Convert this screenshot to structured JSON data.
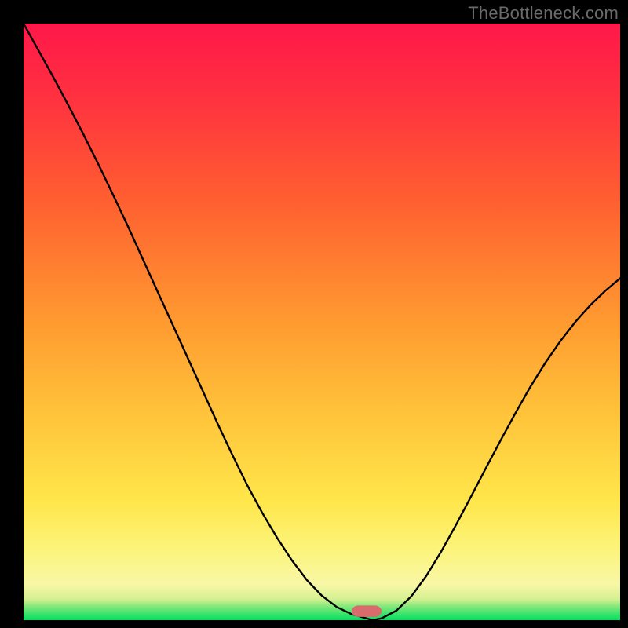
{
  "watermark": "TheBottleneck.com",
  "colors": {
    "black": "#000000",
    "curve": "#000000",
    "marker": "#d86b6b"
  },
  "chart_data": {
    "type": "line",
    "title": "",
    "xlabel": "",
    "ylabel": "",
    "xlim": [
      0,
      100
    ],
    "ylim": [
      0,
      100
    ],
    "gradient_background": {
      "stops": [
        {
          "pos": 0.0,
          "color": "#00e060"
        },
        {
          "pos": 0.022,
          "color": "#7de87a"
        },
        {
          "pos": 0.035,
          "color": "#d4f090"
        },
        {
          "pos": 0.06,
          "color": "#f8f7a6"
        },
        {
          "pos": 0.12,
          "color": "#fcf47a"
        },
        {
          "pos": 0.2,
          "color": "#ffe64a"
        },
        {
          "pos": 0.35,
          "color": "#ffc23a"
        },
        {
          "pos": 0.5,
          "color": "#ff9a30"
        },
        {
          "pos": 0.7,
          "color": "#ff6030"
        },
        {
          "pos": 0.88,
          "color": "#ff3040"
        },
        {
          "pos": 1.0,
          "color": "#ff184a"
        }
      ]
    },
    "series": [
      {
        "name": "bottleneck-curve",
        "x": [
          0.0,
          2.5,
          5.0,
          7.5,
          10.0,
          12.5,
          15.0,
          17.5,
          20.0,
          22.5,
          25.0,
          27.5,
          30.0,
          32.5,
          35.0,
          37.5,
          40.0,
          42.5,
          45.0,
          47.5,
          50.0,
          52.5,
          55.0,
          57.5,
          58.5,
          60.0,
          62.5,
          65.0,
          67.5,
          70.0,
          72.5,
          75.0,
          77.5,
          80.0,
          82.5,
          85.0,
          87.5,
          90.0,
          92.5,
          95.0,
          97.5,
          100.0
        ],
        "y": [
          100.0,
          95.5,
          91.0,
          86.3,
          81.5,
          76.5,
          71.3,
          66.0,
          60.5,
          55.0,
          49.5,
          44.0,
          38.5,
          33.0,
          27.7,
          22.6,
          18.0,
          13.8,
          10.0,
          6.7,
          4.1,
          2.2,
          1.0,
          0.3,
          0.0,
          0.3,
          1.6,
          4.0,
          7.4,
          11.5,
          16.0,
          20.7,
          25.5,
          30.2,
          34.8,
          39.2,
          43.2,
          46.8,
          50.0,
          52.8,
          55.2,
          57.3
        ]
      }
    ],
    "marker": {
      "x1": 55.0,
      "x2": 60.0,
      "y": 0.55,
      "height": 1.9,
      "rx": 1.1
    }
  }
}
